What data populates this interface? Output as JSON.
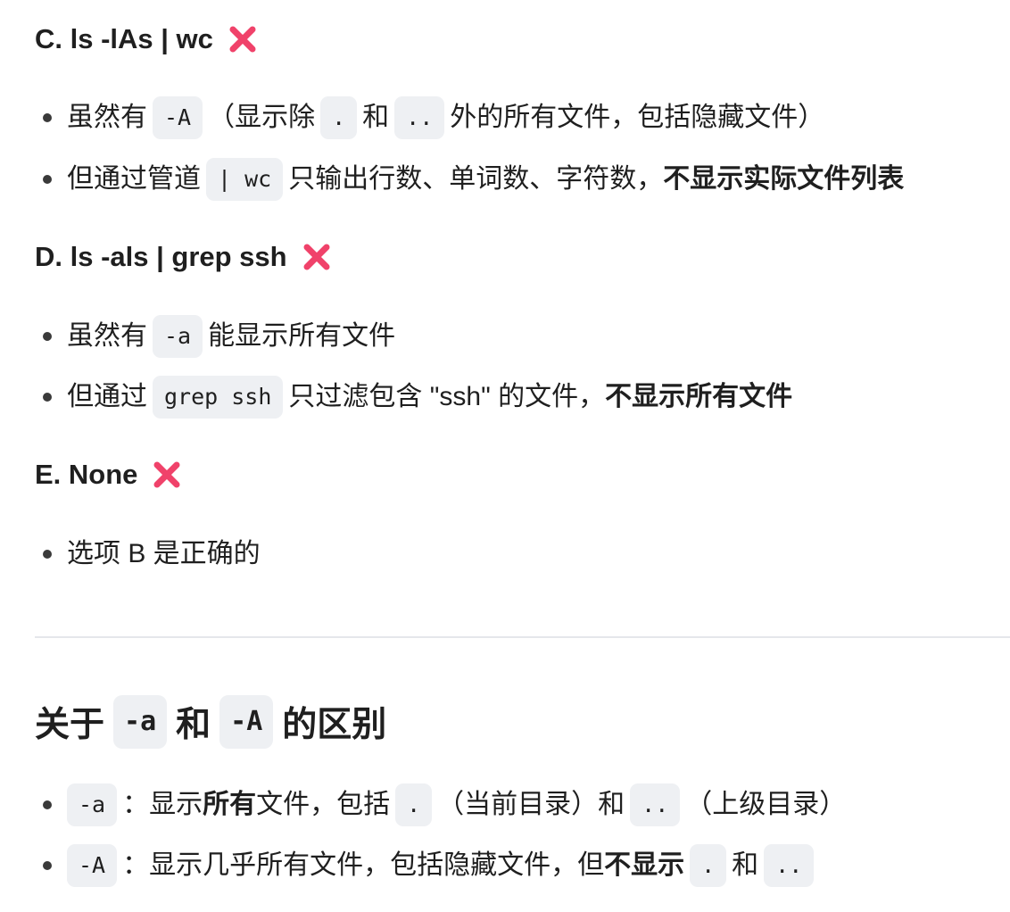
{
  "sections": {
    "c": {
      "heading": "C. ls -lAs | wc",
      "bullet1": {
        "pre": "虽然有",
        "code1": "-A",
        "mid": "（显示除",
        "code2": ".",
        "and": "和",
        "code3": "..",
        "post": "外的所有文件，包括隐藏文件）"
      },
      "bullet2": {
        "pre": "但通过管道",
        "code1": "| wc",
        "mid": "只输出行数、单词数、字符数，",
        "bold": "不显示实际文件列表"
      }
    },
    "d": {
      "heading": "D. ls -als | grep ssh",
      "bullet1": {
        "pre": "虽然有",
        "code1": "-a",
        "post": "能显示所有文件"
      },
      "bullet2": {
        "pre": "但通过",
        "code1": "grep ssh",
        "mid": "只过滤包含 \"ssh\" 的文件，",
        "bold": "不显示所有文件"
      }
    },
    "e": {
      "heading": "E. None",
      "bullet1": {
        "text": "选项 B 是正确的"
      }
    }
  },
  "diff": {
    "title_pre": "关于",
    "title_code1": "-a",
    "title_and": "和",
    "title_code2": "-A",
    "title_post": "的区别",
    "item1": {
      "code": "-a",
      "colon": "：显示",
      "bold": "所有",
      "mid": "文件，包括",
      "code2": ".",
      "mid2": "（当前目录）和",
      "code3": "..",
      "post": "（上级目录）"
    },
    "item2": {
      "code": "-A",
      "colon": "：显示几乎所有文件，包括隐藏文件，但",
      "bold": "不显示",
      "code2": ".",
      "and": "和",
      "code3": ".."
    }
  },
  "icons": {
    "cross": "cross-mark-icon",
    "cross_color": "#f0426a"
  }
}
